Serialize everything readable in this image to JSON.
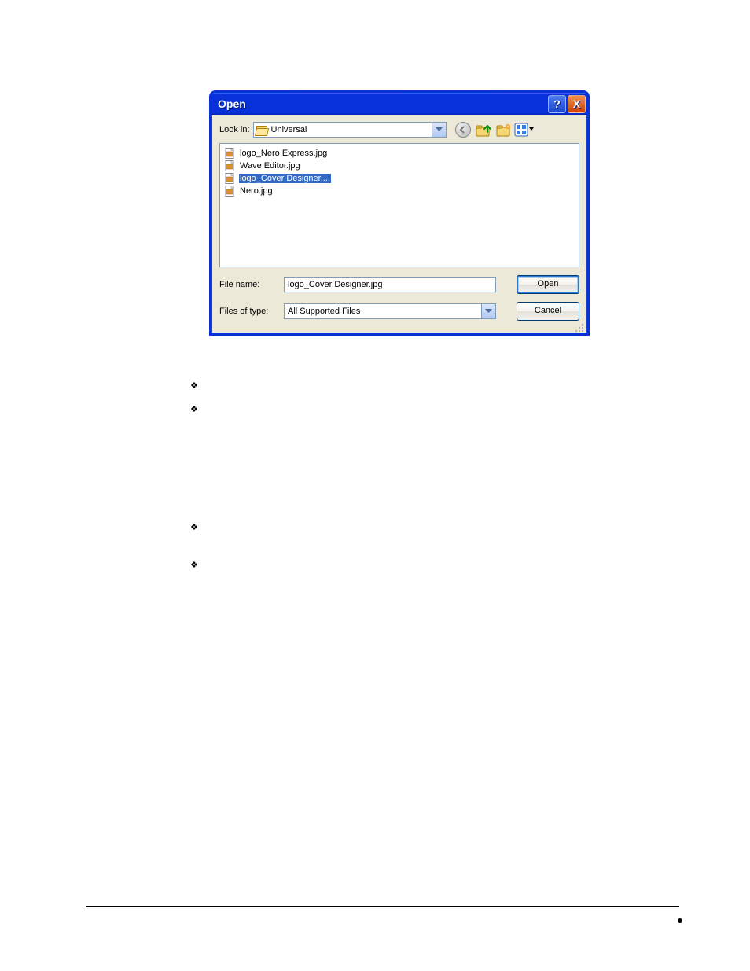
{
  "dialog": {
    "title": "Open",
    "lookin_label": "Look in:",
    "lookin_value": "Universal",
    "files": [
      {
        "name": "logo_Nero Express.jpg",
        "selected": false
      },
      {
        "name": "Wave Editor.jpg",
        "selected": false
      },
      {
        "name": "logo_Cover Designer....",
        "selected": true
      },
      {
        "name": "Nero.jpg",
        "selected": false
      }
    ],
    "filename_label": "File name:",
    "filename_value": "logo_Cover Designer.jpg",
    "filetype_label": "Files of type:",
    "filetype_value": "All Supported Files",
    "open_button": "Open",
    "cancel_button": "Cancel",
    "help_btn": "?",
    "close_btn": "X"
  }
}
